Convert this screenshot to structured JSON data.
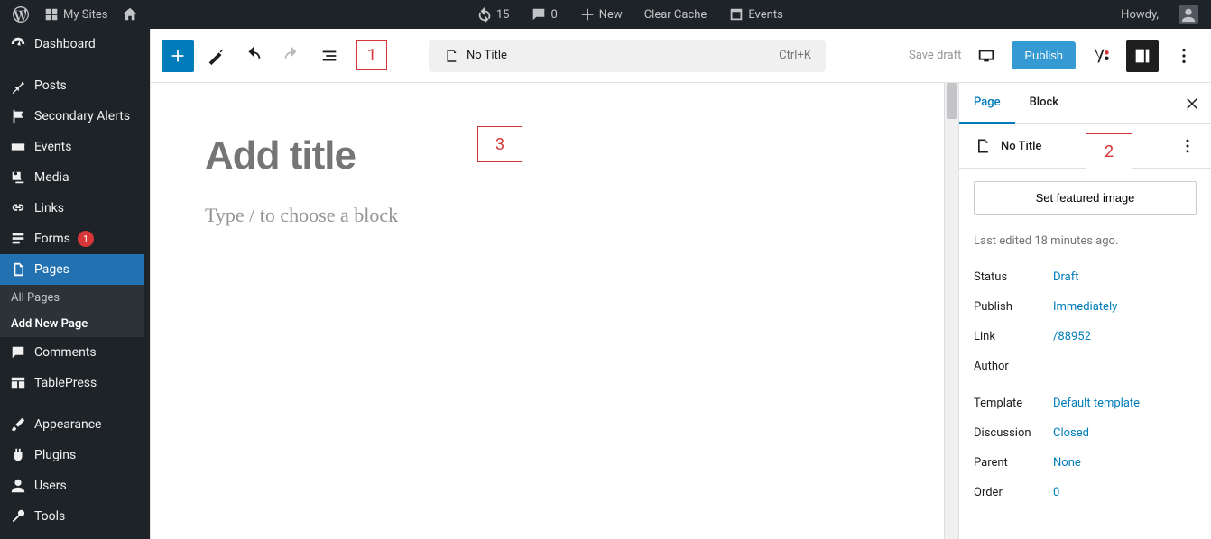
{
  "adminbar": {
    "my_sites": "My Sites",
    "updates": "15",
    "comments": "0",
    "new": "New",
    "clear_cache": "Clear Cache",
    "events": "Events",
    "howdy": "Howdy,"
  },
  "sidebar": {
    "items": [
      {
        "label": "Dashboard"
      },
      {
        "label": "Posts"
      },
      {
        "label": "Secondary Alerts"
      },
      {
        "label": "Events"
      },
      {
        "label": "Media"
      },
      {
        "label": "Links"
      },
      {
        "label": "Forms",
        "badge": "1"
      },
      {
        "label": "Pages"
      },
      {
        "label": "Comments"
      },
      {
        "label": "TablePress"
      },
      {
        "label": "Appearance"
      },
      {
        "label": "Plugins"
      },
      {
        "label": "Users"
      },
      {
        "label": "Tools"
      }
    ],
    "submenu": {
      "all_pages": "All Pages",
      "add_new": "Add New Page"
    }
  },
  "editor": {
    "doc_title": "No Title",
    "doc_shortcut": "Ctrl+K",
    "save_draft": "Save draft",
    "publish": "Publish",
    "title_placeholder": "Add title",
    "body_placeholder": "Type / to choose a block"
  },
  "settings": {
    "tabs": {
      "page": "Page",
      "block": "Block"
    },
    "page_title": "No Title",
    "featured_btn": "Set featured image",
    "last_edited": "Last edited 18 minutes ago.",
    "rows": [
      {
        "k": "Status",
        "v": "Draft"
      },
      {
        "k": "Publish",
        "v": "Immediately"
      },
      {
        "k": "Link",
        "v": "/88952"
      },
      {
        "k": "Author",
        "v": ""
      },
      {
        "k": "Template",
        "v": "Default template"
      },
      {
        "k": "Discussion",
        "v": "Closed"
      },
      {
        "k": "Parent",
        "v": "None"
      },
      {
        "k": "Order",
        "v": "0"
      }
    ]
  },
  "annotations": [
    "1",
    "2",
    "3"
  ]
}
